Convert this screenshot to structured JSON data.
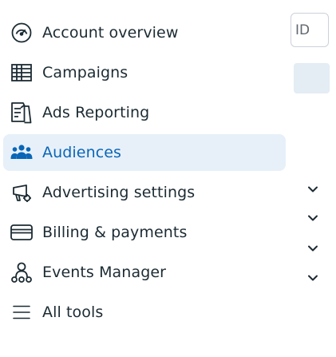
{
  "nav": {
    "items": [
      {
        "label": "Account overview",
        "icon": "gauge-icon",
        "active": false
      },
      {
        "label": "Campaigns",
        "icon": "table-grid-icon",
        "active": false
      },
      {
        "label": "Ads Reporting",
        "icon": "report-document-icon",
        "active": false
      },
      {
        "label": "Audiences",
        "icon": "people-group-icon",
        "active": true
      },
      {
        "label": "Advertising settings",
        "icon": "megaphone-gear-icon",
        "active": false
      },
      {
        "label": "Billing & payments",
        "icon": "credit-card-icon",
        "active": false
      },
      {
        "label": "Events Manager",
        "icon": "people-network-icon",
        "active": false
      },
      {
        "label": "All tools",
        "icon": "hamburger-menu-icon",
        "active": false
      }
    ]
  },
  "right_panel": {
    "id_field_text": "ID",
    "chevrons": [
      "chevron-down-icon",
      "chevron-down-icon",
      "chevron-down-icon",
      "chevron-down-icon"
    ]
  },
  "colors": {
    "active_bg": "#e7f0f9",
    "active_text": "#0a66b7",
    "text": "#1c2b33"
  }
}
